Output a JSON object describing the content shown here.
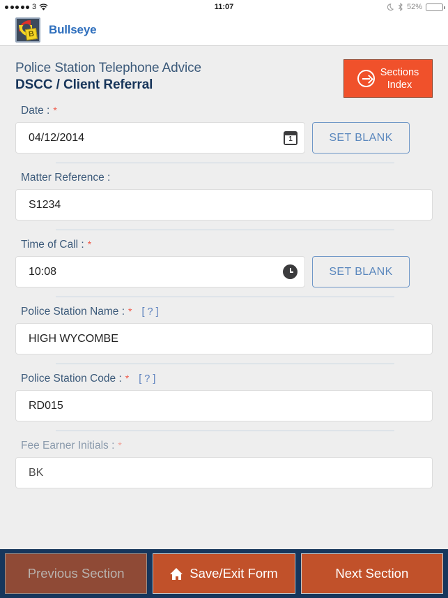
{
  "status_bar": {
    "signal_dots": 5,
    "carrier": "3",
    "wifi_icon": "wifi-icon",
    "time": "11:07",
    "dnd_icon": "moon-icon",
    "bluetooth_icon": "bluetooth-icon",
    "battery_percent": "52%",
    "battery_level": 52
  },
  "app_header": {
    "logo_icon": "bullseye-logo",
    "logo_letter": "B",
    "app_name": "Bullseye"
  },
  "page": {
    "title": "Police Station Telephone Advice",
    "subtitle": "DSCC / Client Referral",
    "sections_button": {
      "icon": "arrow-circle-right-icon",
      "line1": "Sections",
      "line2": "Index"
    }
  },
  "form": {
    "fields": [
      {
        "name": "date",
        "label": "Date :",
        "required": true,
        "required_mark": "*",
        "help": null,
        "value": "04/12/2014",
        "icon": "calendar-icon",
        "icon_day": "1",
        "set_blank_label": "SET BLANK"
      },
      {
        "name": "matter-reference",
        "label": "Matter Reference :",
        "required": false,
        "required_mark": "",
        "help": null,
        "value": "S1234",
        "icon": null,
        "set_blank_label": null
      },
      {
        "name": "time-of-call",
        "label": "Time of Call :",
        "required": true,
        "required_mark": "*",
        "help": null,
        "value": "10:08",
        "icon": "clock-icon",
        "set_blank_label": "SET BLANK"
      },
      {
        "name": "police-station-name",
        "label": "Police Station Name :",
        "required": true,
        "required_mark": "*",
        "help": "[ ? ]",
        "value": "HIGH WYCOMBE",
        "icon": null,
        "set_blank_label": null
      },
      {
        "name": "police-station-code",
        "label": "Police Station Code :",
        "required": true,
        "required_mark": "*",
        "help": "[ ? ]",
        "value": "RD015",
        "icon": null,
        "set_blank_label": null
      },
      {
        "name": "fee-earner-initials",
        "label": "Fee Earner Initials :",
        "required": true,
        "required_mark": "*",
        "help": null,
        "value": "BK",
        "icon": null,
        "set_blank_label": null
      }
    ]
  },
  "toolbar": {
    "previous_label": "Previous Section",
    "save_icon": "home-icon",
    "save_label": "Save/Exit Form",
    "next_label": "Next Section"
  },
  "colors": {
    "accent_orange": "#f0512b",
    "toolbar_navy": "#16365c",
    "toolbar_button_active": "#c1512a",
    "toolbar_button_disabled": "#8f4a36",
    "label_blue": "#3c5a7a",
    "required_red": "#f05a4a",
    "link_blue": "#5a7fbd",
    "app_name_blue": "#2f6fbd",
    "page_background": "#eeeeee"
  }
}
